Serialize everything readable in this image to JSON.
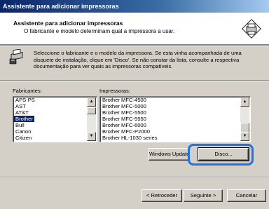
{
  "window": {
    "title": "Assistente para adicionar impressoras"
  },
  "header": {
    "title": "Assistente para adicionar impressoras",
    "subtitle": "O fabricante e modelo determinam qual a impressora a usar.",
    "icon": "printer-wizard-icon"
  },
  "info": {
    "icon": "printer-setup-icon",
    "text": "Seleccione o fabricante e o modelo da impressora. Se esta vinha acompanhada de uma disquete de instalação, clique em 'Disco'. Se não constar da lista, consulte a respectiva documentação para ver quais as impressoras compatíveis."
  },
  "manufacturers": {
    "label": "Fabricantes:",
    "items": [
      "APS-PS",
      "AST",
      "AT&T",
      "Brother",
      "Bull",
      "Canon",
      "Citizen"
    ],
    "selected": "Brother"
  },
  "printers": {
    "label": "Impressoras:",
    "items": [
      "Brother MFC-4500",
      "Brother MFC-5000",
      "Brother MFC-5500",
      "Brother MFC-5550",
      "Brother MFC-6000",
      "Brother MFC-P2000",
      "Brother HL-1030 series"
    ]
  },
  "buttons": {
    "windows_update": "Windows Update",
    "disk": "Disco...",
    "back": "< Retroceder",
    "next": "Seguinte >",
    "cancel": "Cancelar"
  },
  "colors": {
    "highlight": "#1e73e8",
    "title_bar": "#0a246a",
    "selection": "#0a246a"
  }
}
